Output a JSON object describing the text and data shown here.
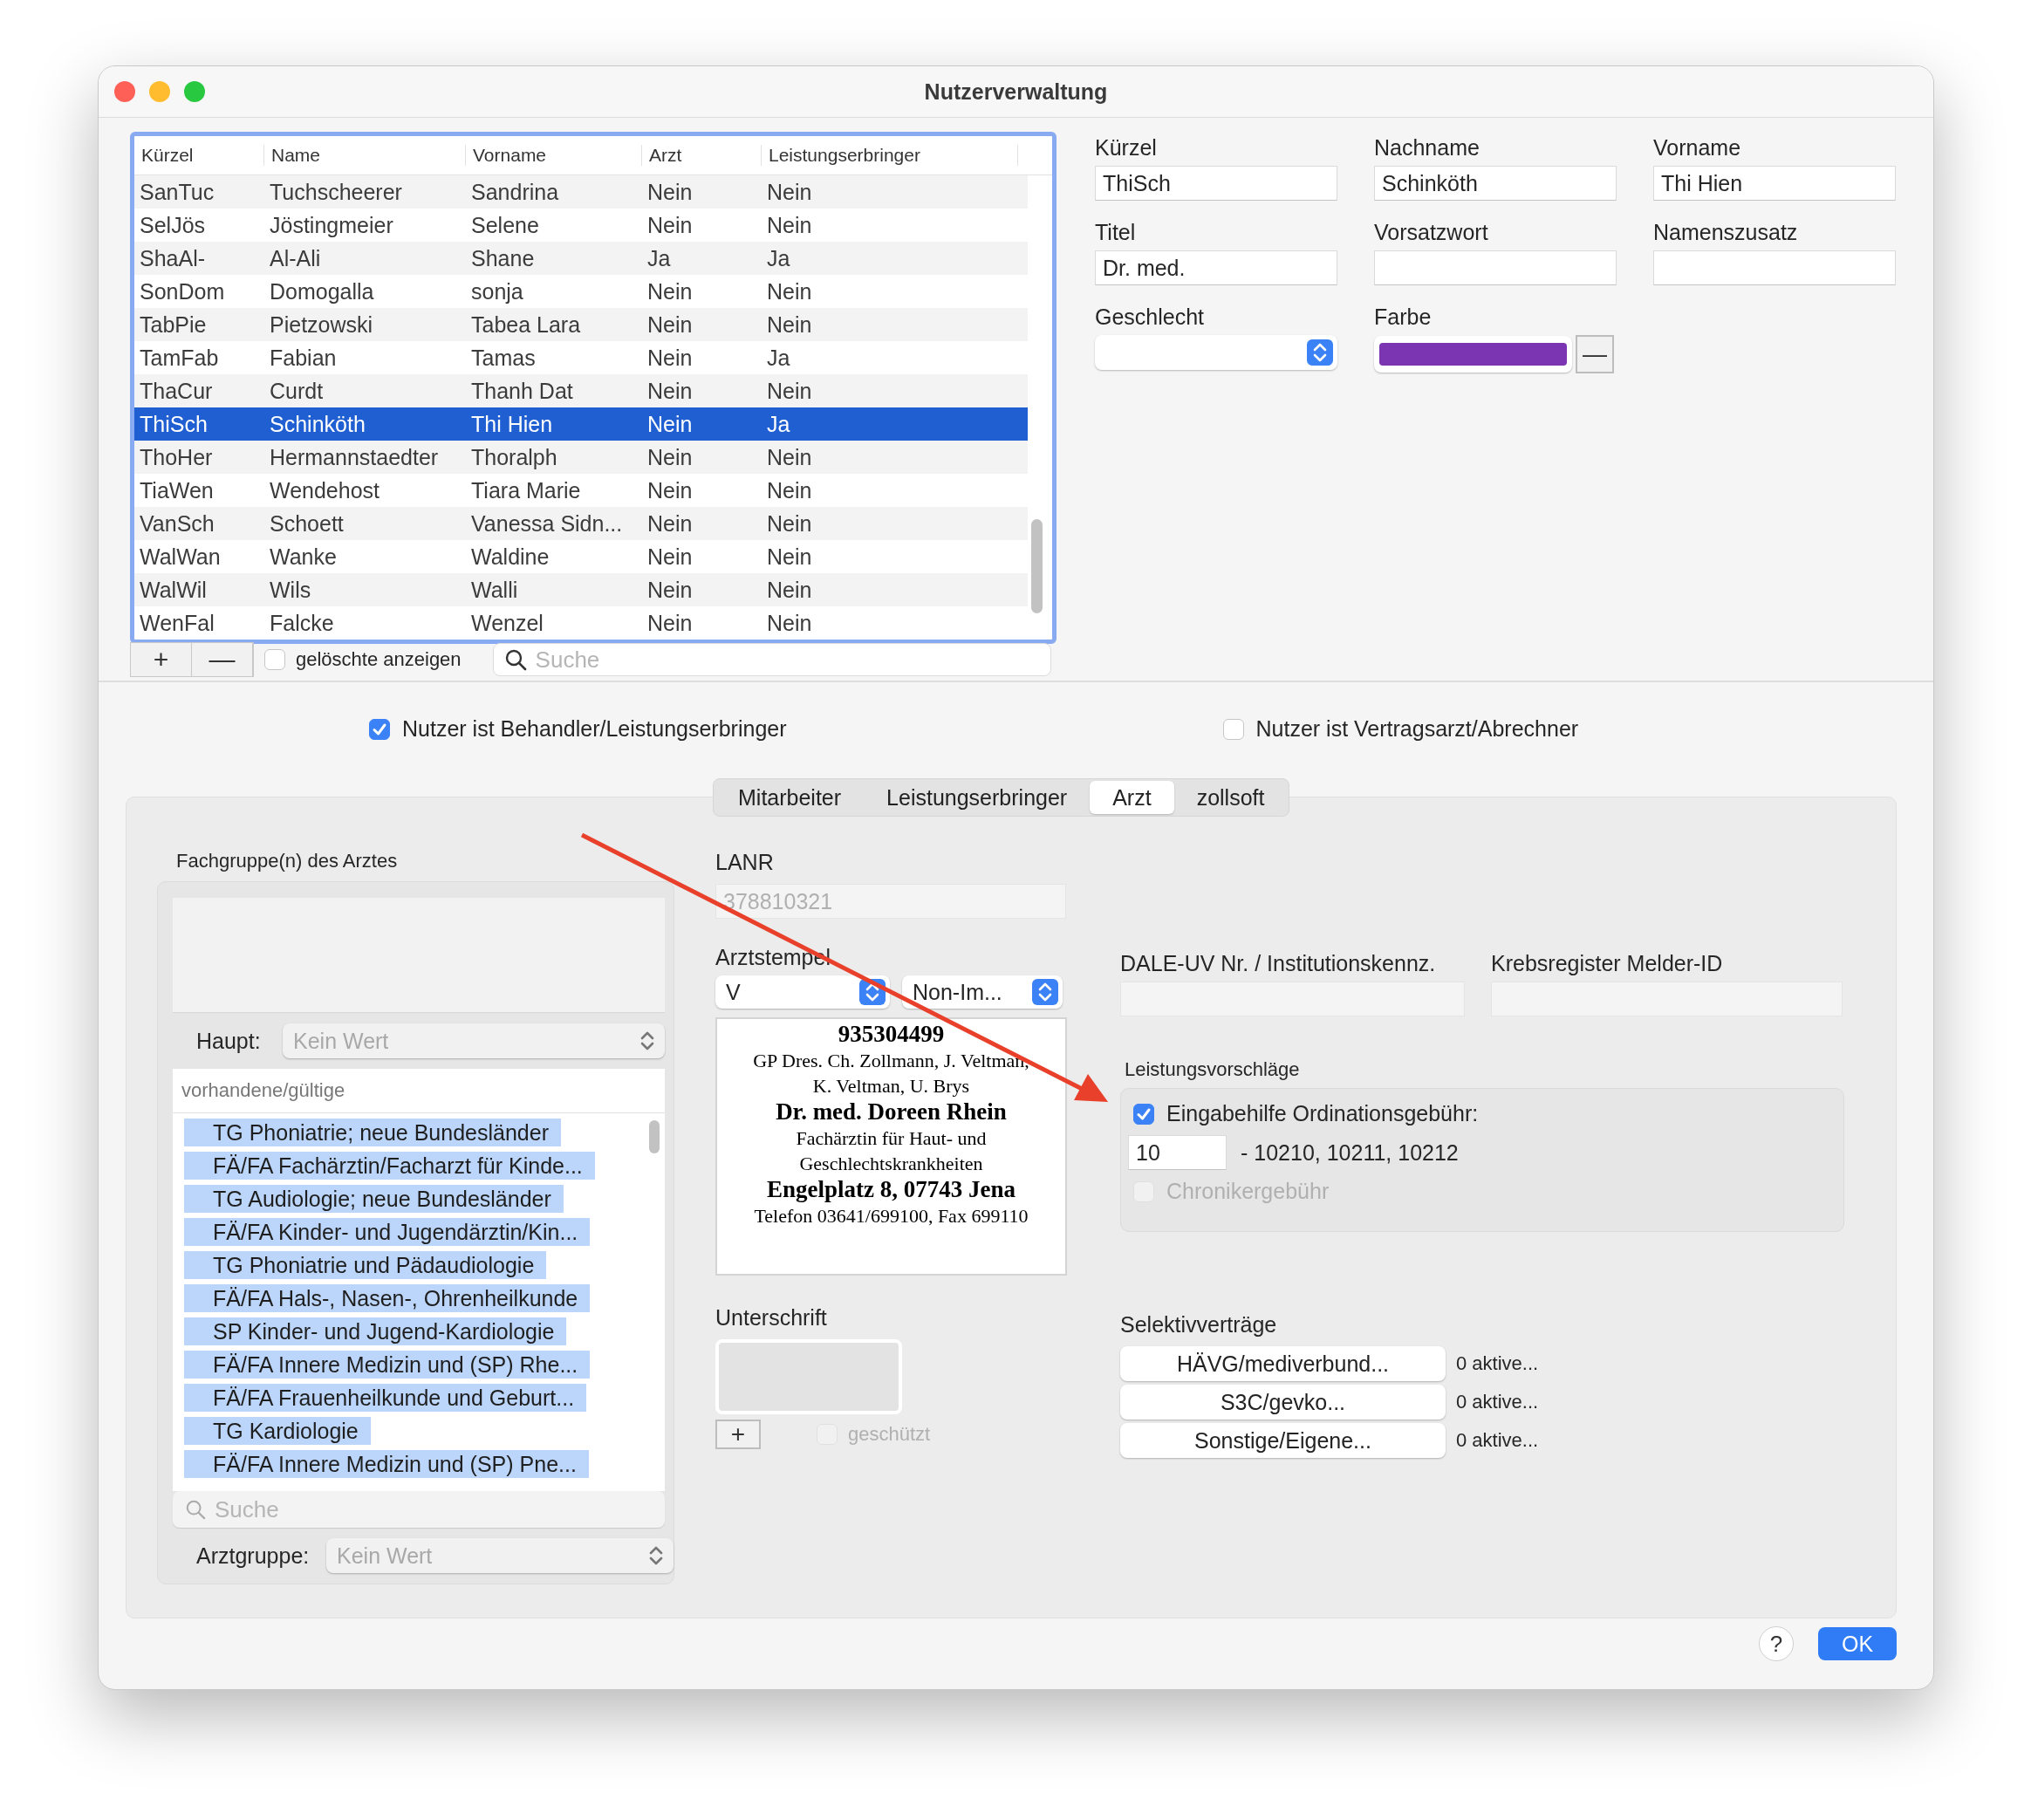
{
  "window": {
    "title": "Nutzerverwaltung"
  },
  "user_table": {
    "columns": [
      "Kürzel",
      "Name",
      "Vorname",
      "Arzt",
      "Leistungserbringer"
    ],
    "rows": [
      {
        "cells": [
          "SanTuc",
          "Tuchscheerer",
          "Sandrina",
          "Nein",
          "Nein"
        ],
        "selected": false
      },
      {
        "cells": [
          "SelJös",
          "Jöstingmeier",
          "Selene",
          "Nein",
          "Nein"
        ],
        "selected": false
      },
      {
        "cells": [
          "ShaAl-",
          "Al-Ali",
          "Shane",
          "Ja",
          "Ja"
        ],
        "selected": false
      },
      {
        "cells": [
          "SonDom",
          "Domogalla",
          "sonja",
          "Nein",
          "Nein"
        ],
        "selected": false
      },
      {
        "cells": [
          "TabPie",
          "Pietzowski",
          "Tabea Lara",
          "Nein",
          "Nein"
        ],
        "selected": false
      },
      {
        "cells": [
          "TamFab",
          "Fabian",
          "Tamas",
          "Nein",
          "Ja"
        ],
        "selected": false
      },
      {
        "cells": [
          "ThaCur",
          "Curdt",
          "Thanh Dat",
          "Nein",
          "Nein"
        ],
        "selected": false
      },
      {
        "cells": [
          "ThiSch",
          "Schinköth",
          "Thi Hien",
          "Nein",
          "Ja"
        ],
        "selected": true
      },
      {
        "cells": [
          "ThoHer",
          "Hermannstaedter",
          "Thoralph",
          "Nein",
          "Nein"
        ],
        "selected": false
      },
      {
        "cells": [
          "TiaWen",
          "Wendehost",
          "Tiara Marie",
          "Nein",
          "Nein"
        ],
        "selected": false
      },
      {
        "cells": [
          "VanSch",
          "Schoett",
          "Vanessa Sidn...",
          "Nein",
          "Nein"
        ],
        "selected": false
      },
      {
        "cells": [
          "WalWan",
          "Wanke",
          "Waldine",
          "Nein",
          "Nein"
        ],
        "selected": false
      },
      {
        "cells": [
          "WalWil",
          "Wils",
          "Walli",
          "Nein",
          "Nein"
        ],
        "selected": false
      },
      {
        "cells": [
          "WenFal",
          "Falcke",
          "Wenzel",
          "Nein",
          "Nein"
        ],
        "selected": false
      }
    ]
  },
  "table_toolbar": {
    "add_button": "+",
    "remove_button": "—",
    "show_deleted": {
      "label": "gelöschte anzeigen",
      "checked": false
    },
    "search": {
      "placeholder": "Suche"
    }
  },
  "details": {
    "fields": [
      {
        "label": "Kürzel",
        "value": "ThiSch"
      },
      {
        "label": "Nachname",
        "value": "Schinköth"
      },
      {
        "label": "Vorname",
        "value": "Thi Hien"
      },
      {
        "label": "Titel",
        "value": "Dr. med."
      },
      {
        "label": "Vorsatzwort"
      },
      {
        "label": "Namenszusatz"
      }
    ],
    "gender": {
      "label": "Geschlecht"
    },
    "color": {
      "label": "Farbe",
      "color": "#7b35b3",
      "clear_button": "—"
    }
  },
  "options": [
    {
      "label": "Nutzer ist Behandler/Leistungserbringer",
      "checked": true
    },
    {
      "label": "Nutzer ist Vertragsarzt/Abrechner",
      "checked": false
    }
  ],
  "tabs": [
    {
      "label": "Mitarbeiter",
      "selected": false
    },
    {
      "label": "Leistungserbringer",
      "selected": false
    },
    {
      "label": "Arzt",
      "selected": true
    },
    {
      "label": "zollsoft",
      "selected": false
    }
  ],
  "specialties": {
    "title": "Fachgruppe(n) des Arztes",
    "main": {
      "label": "Haupt:",
      "value": "Kein Wert",
      "disabled": true
    },
    "list_header": "vorhandene/gültige",
    "items": [
      {
        "label": "TG Phoniatrie; neue Bundesländer",
        "selected": true
      },
      {
        "label": "FÄ/FA Fachärztin/Facharzt für Kinde...",
        "selected": true
      },
      {
        "label": "TG Audiologie; neue Bundesländer",
        "selected": true
      },
      {
        "label": "FÄ/FA Kinder- und Jugendärztin/Kin...",
        "selected": true
      },
      {
        "label": "TG Phoniatrie und Pädaudiologie",
        "selected": true
      },
      {
        "label": "FÄ/FA Hals-, Nasen-, Ohrenheilkunde",
        "selected": true
      },
      {
        "label": "SP Kinder- und Jugend-Kardiologie",
        "selected": true
      },
      {
        "label": "FÄ/FA Innere Medizin und (SP) Rhe...",
        "selected": true
      },
      {
        "label": "FÄ/FA Frauenheilkunde und Geburt...",
        "selected": true
      },
      {
        "label": "TG Kardiologie",
        "selected": true
      },
      {
        "label": "FÄ/FA Innere Medizin und (SP) Pne...",
        "selected": true
      }
    ],
    "search": {
      "placeholder": "Suche"
    },
    "group": {
      "label": "Arztgruppe:",
      "value": "Kein Wert",
      "disabled": true
    }
  },
  "lanr": {
    "label": "LANR",
    "value": "378810321",
    "disabled": true
  },
  "stamp": {
    "label": "Arztstempel",
    "selects": [
      "V",
      "Non-Im..."
    ],
    "lines": [
      {
        "text": "935304499",
        "bold": true
      },
      {
        "text": "GP Dres. Ch. Zollmann, J. Veltman,",
        "bold": false
      },
      {
        "text": "K. Veltman, U. Brys",
        "bold": false
      },
      {
        "text": "Dr. med. Doreen Rhein",
        "bold": true
      },
      {
        "text": "Fachärztin für Haut- und",
        "bold": false
      },
      {
        "text": "Geschlechtskrankheiten",
        "bold": false
      },
      {
        "text": "Engelplatz 8, 07743 Jena",
        "bold": true
      },
      {
        "text": "Telefon 03641/699100, Fax 699110",
        "bold": false
      }
    ]
  },
  "signature": {
    "label": "Unterschrift",
    "add_button": "+",
    "protected": {
      "label": "geschützt",
      "checked": false,
      "disabled": true
    }
  },
  "ids": [
    {
      "label": "DALE-UV Nr. / Institutionskennz."
    },
    {
      "label": "Krebsregister Melder-ID"
    }
  ],
  "suggestions": {
    "title": "Leistungsvorschläge",
    "fee": {
      "label": "Eingabehilfe Ordinationsgebühr:",
      "checked": true,
      "value": "10",
      "codes": "- 10210, 10211, 10212"
    },
    "chronic": {
      "label": "Chronikergebühr",
      "checked": false,
      "disabled": true
    }
  },
  "contracts": {
    "title": "Selektivverträge",
    "items": [
      {
        "button": "HÄVG/mediverbund...",
        "status": "0 aktive..."
      },
      {
        "button": "S3C/gevko...",
        "status": "0 aktive..."
      },
      {
        "button": "Sonstige/Eigene...",
        "status": "0 aktive..."
      }
    ]
  },
  "footer": {
    "help_button": "?",
    "ok_button": "OK"
  }
}
